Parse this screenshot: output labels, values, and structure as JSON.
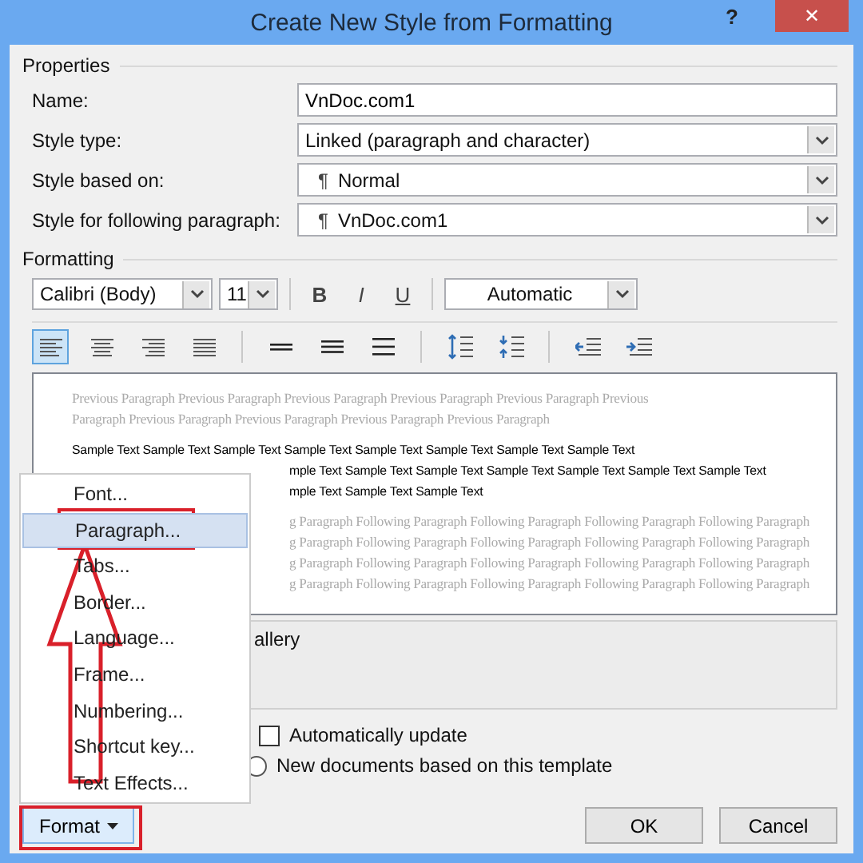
{
  "window": {
    "title": "Create New Style from Formatting",
    "help": "?",
    "close": "✕"
  },
  "properties": {
    "heading": "Properties",
    "rows": [
      {
        "label": "Name:",
        "kind": "text",
        "value": "VnDoc.com1"
      },
      {
        "label": "Style type:",
        "kind": "dropdown",
        "value": "Linked (paragraph and character)"
      },
      {
        "label": "Style based on:",
        "kind": "dropdown",
        "mark": "¶",
        "value": "Normal"
      },
      {
        "label": "Style for following paragraph:",
        "kind": "dropdown",
        "mark": "¶",
        "value": "VnDoc.com1"
      }
    ]
  },
  "formatting": {
    "heading": "Formatting",
    "font": "Calibri (Body)",
    "size": "11",
    "bold": "B",
    "italic": "I",
    "underline": "U",
    "font_color": "Automatic",
    "align_buttons": [
      {
        "kind": "left",
        "selected": true
      },
      {
        "kind": "center",
        "selected": false
      },
      {
        "kind": "right",
        "selected": false
      },
      {
        "kind": "justify",
        "selected": false
      }
    ]
  },
  "preview": {
    "previous": [
      "Previous Paragraph Previous Paragraph Previous Paragraph Previous Paragraph Previous Paragraph Previous",
      "Paragraph Previous Paragraph Previous Paragraph Previous Paragraph Previous Paragraph"
    ],
    "sample": [
      "Sample Text Sample Text Sample Text Sample Text Sample Text Sample Text Sample Text Sample Text",
      "mple Text Sample Text Sample Text Sample Text Sample Text Sample Text Sample Text",
      "mple Text Sample Text Sample Text"
    ],
    "following": [
      "g Paragraph Following Paragraph Following Paragraph Following Paragraph Following Paragraph",
      "g Paragraph Following Paragraph Following Paragraph Following Paragraph Following Paragraph",
      "g Paragraph Following Paragraph Following Paragraph Following Paragraph Following Paragraph",
      "g Paragraph Following Paragraph Following Paragraph Following Paragraph Following Paragraph"
    ]
  },
  "description": "allery",
  "options": [
    {
      "kind": "checkbox",
      "label": "Automatically update",
      "checked": false
    },
    {
      "kind": "radio",
      "label": "New documents based on this template",
      "selected": false
    }
  ],
  "menu": [
    {
      "label": "Font...",
      "selected": false
    },
    {
      "label": "Paragraph...",
      "selected": true
    },
    {
      "label": "Tabs...",
      "selected": false
    },
    {
      "label": "Border...",
      "selected": false
    },
    {
      "label": "Language...",
      "selected": false
    },
    {
      "label": "Frame...",
      "selected": false
    },
    {
      "label": "Numbering...",
      "selected": false
    },
    {
      "label": "Shortcut key...",
      "selected": false
    },
    {
      "label": "Text Effects...",
      "selected": false
    }
  ],
  "buttons": {
    "format": "Format",
    "ok": "OK",
    "cancel": "Cancel"
  }
}
